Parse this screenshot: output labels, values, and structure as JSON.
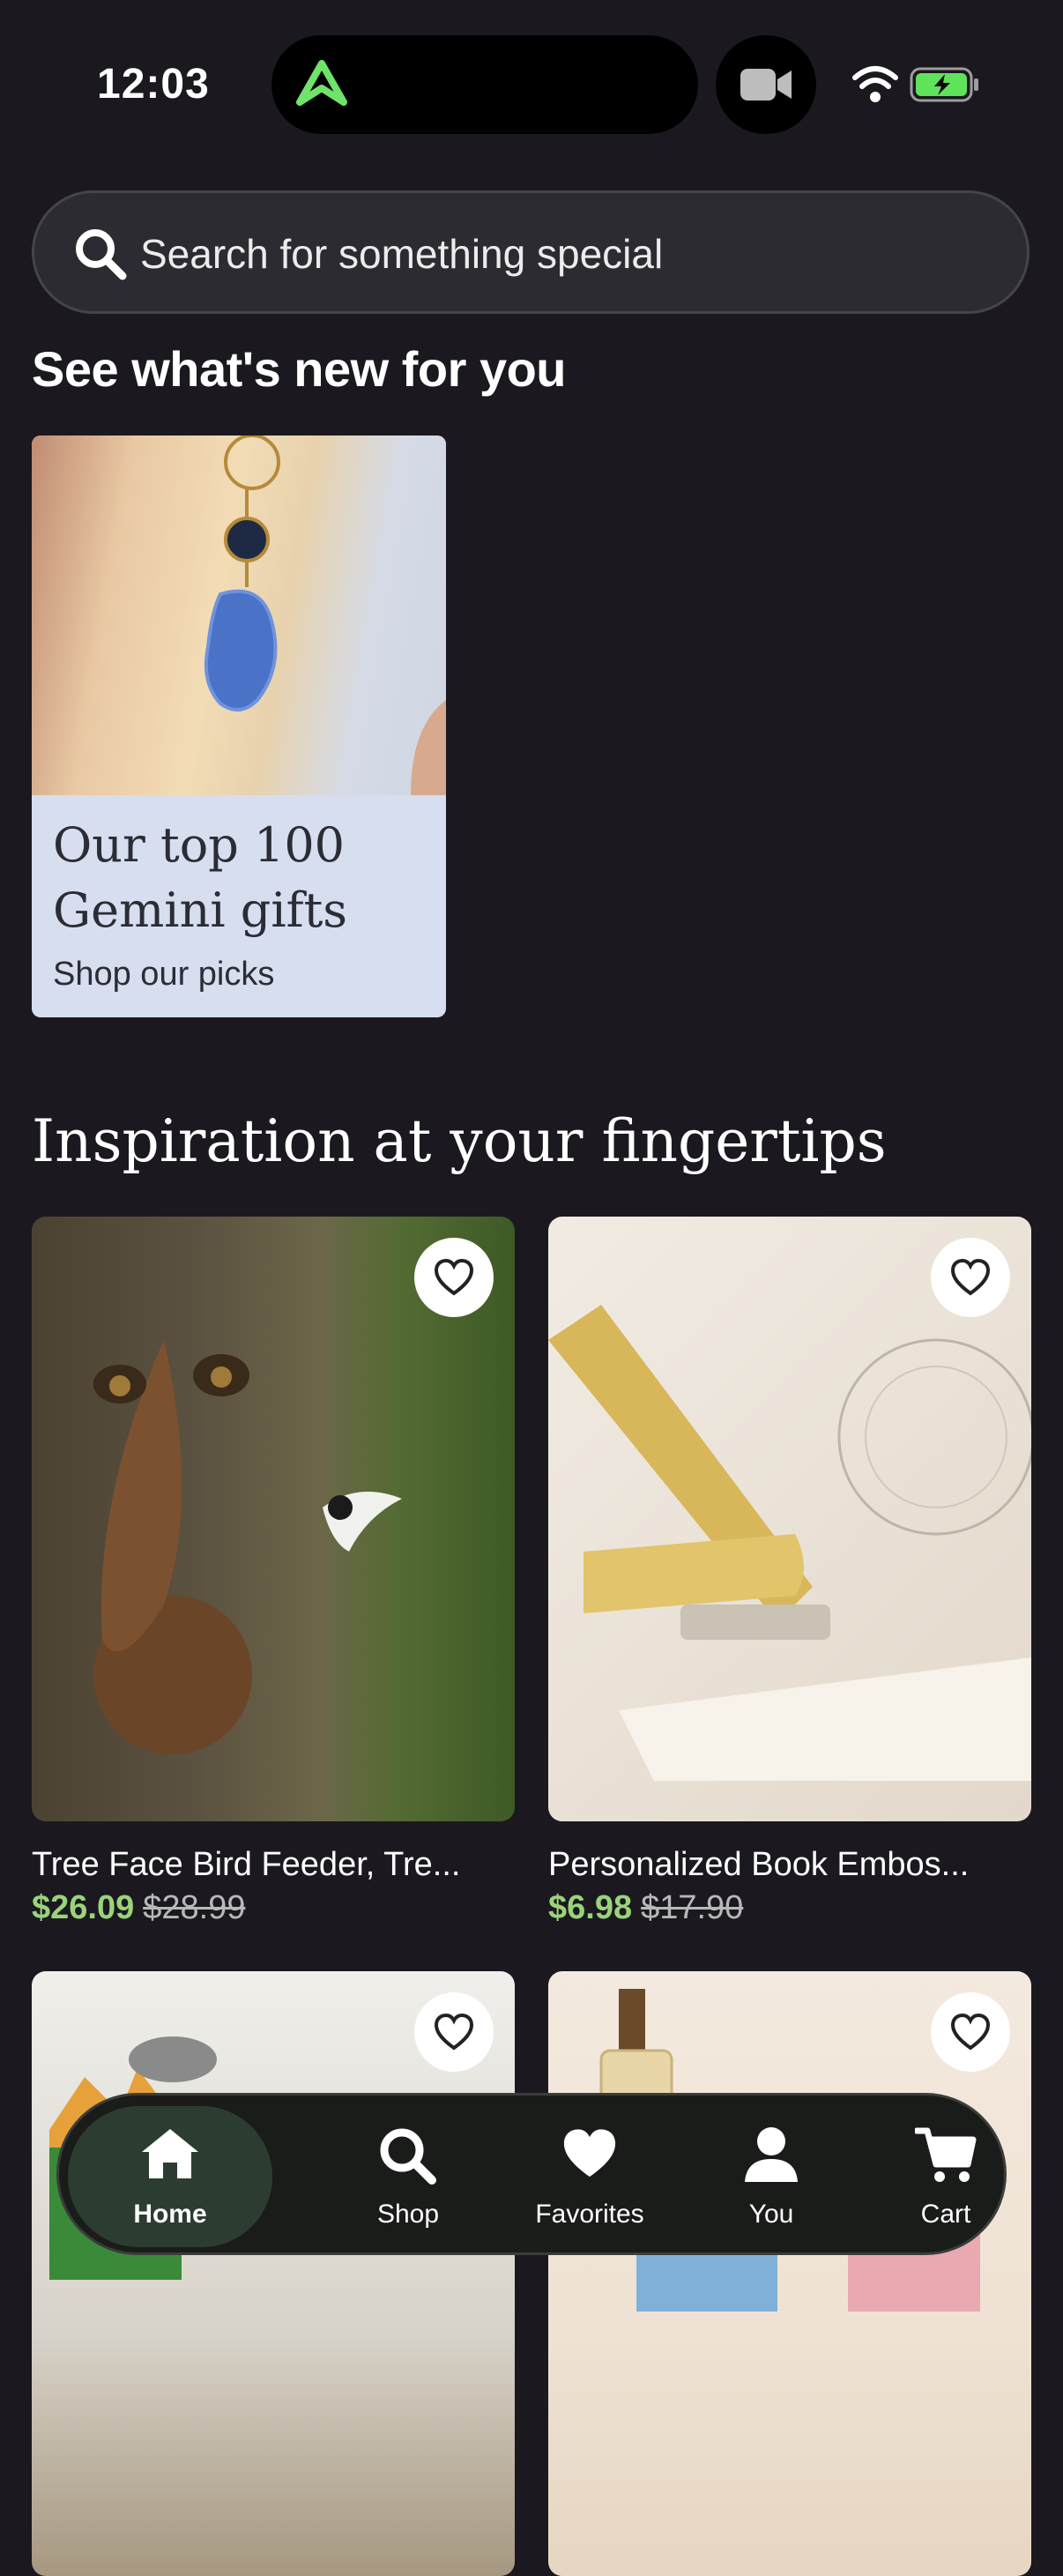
{
  "status_bar": {
    "time": "12:03"
  },
  "search": {
    "placeholder": "Search for something special"
  },
  "section_new": {
    "title": "See what's new for you"
  },
  "promo": {
    "heading": "Our top 100 Gemini gifts",
    "subtext": "Shop our picks"
  },
  "section_inspiration": {
    "title": "Inspiration at your fingertips"
  },
  "products": [
    {
      "title": "Tree Face Bird Feeder, Tre...",
      "price": "$26.09",
      "original_price": "$28.99"
    },
    {
      "title": "Personalized Book Embos...",
      "price": "$6.98",
      "original_price": "$17.90"
    },
    {
      "title": "",
      "price": "",
      "original_price": ""
    },
    {
      "title": "",
      "price": "",
      "original_price": ""
    }
  ],
  "bottom_nav": [
    {
      "label": "Home",
      "icon": "home-icon",
      "active": true
    },
    {
      "label": "Shop",
      "icon": "search-icon"
    },
    {
      "label": "Favorites",
      "icon": "heart-icon"
    },
    {
      "label": "You",
      "icon": "person-icon"
    },
    {
      "label": "Cart",
      "icon": "cart-icon"
    }
  ],
  "colors": {
    "background": "#1b191f",
    "price": "#9ad37a",
    "promo_card": "#d6deef",
    "nav_active": "#2d3c30",
    "app_glyph": "#6fe36a",
    "battery": "#5fe35a"
  }
}
